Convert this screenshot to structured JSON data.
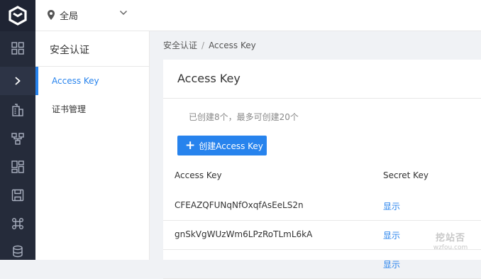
{
  "header": {
    "scope_label": "全局"
  },
  "sidebar": {
    "title": "安全认证",
    "items": [
      {
        "label": "Access Key",
        "active": true
      },
      {
        "label": "证书管理",
        "active": false
      }
    ]
  },
  "breadcrumb": {
    "parent": "安全认证",
    "separator": "/",
    "current": "Access Key"
  },
  "main": {
    "title": "Access Key",
    "quota_text": "已创建8个，最多可创建20个",
    "create_label": "创建Access Key",
    "columns": [
      "Access Key",
      "Secret Key"
    ],
    "rows": [
      {
        "access_key": "CFEAZQFUNqNfOxqfAsEeLS2n",
        "secret_action": "显示"
      },
      {
        "access_key": "gnSkVgWUzWm6LPzRoTLmL6kA",
        "secret_action": "显示"
      },
      {
        "access_key": "",
        "secret_action": "显示"
      }
    ]
  },
  "watermark": {
    "brand": "挖站否",
    "domain": "wzfou.com"
  },
  "colors": {
    "accent": "#2783ed",
    "rail": "#252b3a"
  }
}
